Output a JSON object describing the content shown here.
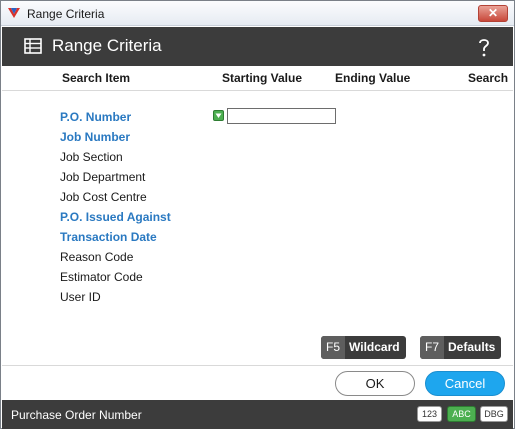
{
  "window": {
    "title": "Range Criteria",
    "close_label": "✕"
  },
  "header": {
    "title": "Range Criteria",
    "help_label": "?"
  },
  "columns": {
    "search_item": "Search Item",
    "starting_value": "Starting Value",
    "ending_value": "Ending Value",
    "search": "Search"
  },
  "fields": [
    {
      "label": "P.O. Number",
      "required": true
    },
    {
      "label": "Job Number",
      "required": true
    },
    {
      "label": "Job Section",
      "required": false
    },
    {
      "label": "Job Department",
      "required": false
    },
    {
      "label": "Job Cost Centre",
      "required": false
    },
    {
      "label": "P.O. Issued Against",
      "required": true
    },
    {
      "label": "Transaction Date",
      "required": true
    },
    {
      "label": "Reason Code",
      "required": false
    },
    {
      "label": "Estimator Code",
      "required": false
    },
    {
      "label": "User ID",
      "required": false
    }
  ],
  "active_field": {
    "starting_value": ""
  },
  "function_keys": {
    "wildcard": {
      "key": "F5",
      "label": "Wildcard"
    },
    "defaults": {
      "key": "F7",
      "label": "Defaults"
    }
  },
  "buttons": {
    "ok": "OK",
    "cancel": "Cancel"
  },
  "status": {
    "text": "Purchase Order Number",
    "badges": [
      {
        "label": "123",
        "active": false
      },
      {
        "label": "ABC",
        "active": true
      },
      {
        "label": "DBG",
        "active": false
      }
    ]
  },
  "colors": {
    "required_label": "#2a79c1",
    "dark_bar": "#3c3c3c",
    "cancel": "#1ea6ee",
    "active_badge": "#4caf50"
  },
  "icons": {
    "app": "app-logo-icon",
    "header": "table-icon",
    "help": "help-icon",
    "valid": "valid-check-icon"
  }
}
